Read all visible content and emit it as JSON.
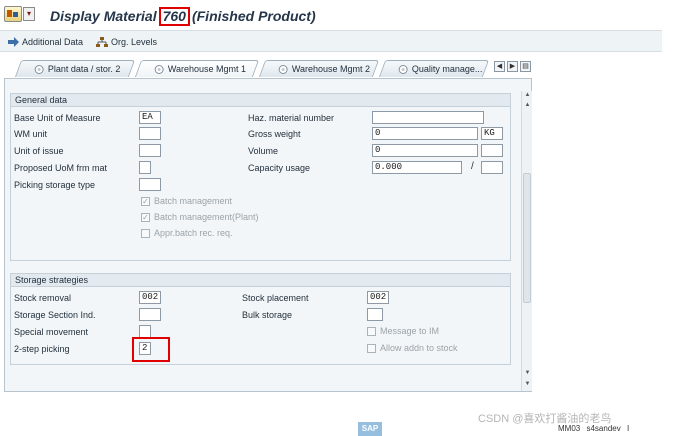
{
  "title": {
    "prefix": "Display Material",
    "material": "760",
    "suffix": "(Finished Product)"
  },
  "toolbar": {
    "additional_data": "Additional Data",
    "org_levels": "Org. Levels"
  },
  "tabs": [
    {
      "label": "Plant data / stor. 2",
      "active": false
    },
    {
      "label": "Warehouse Mgmt 1",
      "active": true
    },
    {
      "label": "Warehouse Mgmt 2",
      "active": false
    },
    {
      "label": "Quality manage...",
      "active": false
    }
  ],
  "general_data": {
    "heading": "General data",
    "base_uom": {
      "label": "Base Unit of Measure",
      "value": "EA"
    },
    "wm_unit": {
      "label": "WM unit",
      "value": ""
    },
    "unit_of_issue": {
      "label": "Unit of issue",
      "value": ""
    },
    "proposed_uom": {
      "label": "Proposed UoM frm mat",
      "value": ""
    },
    "picking_storage_type": {
      "label": "Picking storage type",
      "value": ""
    },
    "haz_material": {
      "label": "Haz. material number",
      "value": ""
    },
    "gross_weight": {
      "label": "Gross weight",
      "value": "0",
      "unit": "KG"
    },
    "volume": {
      "label": "Volume",
      "value": "0",
      "unit": ""
    },
    "capacity_usage": {
      "label": "Capacity usage",
      "value": "0.000",
      "unit": ""
    },
    "batch_management": {
      "label": "Batch management",
      "checked": true
    },
    "batch_management_plant": {
      "label": "Batch management(Plant)",
      "checked": true
    },
    "appr_batch": {
      "label": "Appr.batch rec. req.",
      "checked": false
    }
  },
  "storage_strategies": {
    "heading": "Storage strategies",
    "stock_removal": {
      "label": "Stock removal",
      "value": "002"
    },
    "storage_section_ind": {
      "label": "Storage Section Ind.",
      "value": ""
    },
    "special_movement": {
      "label": "Special movement",
      "value": ""
    },
    "two_step_picking": {
      "label": "2-step picking",
      "value": "2"
    },
    "stock_placement": {
      "label": "Stock placement",
      "value": "002"
    },
    "bulk_storage": {
      "label": "Bulk storage",
      "value": ""
    },
    "message_to_im": {
      "label": "Message to IM",
      "checked": false
    },
    "allow_addn_to_stock": {
      "label": "Allow addn to stock",
      "checked": false
    }
  },
  "footer": {
    "watermark": "CSDN @喜欢打酱油的老鸟",
    "sap_logo": "SAP",
    "transaction": "MM03",
    "system": "s4sandev",
    "indicator": "I"
  },
  "colors": {
    "highlight_box": "#e00000",
    "title_text": "#25364a",
    "group_header": "#e3eaef"
  }
}
